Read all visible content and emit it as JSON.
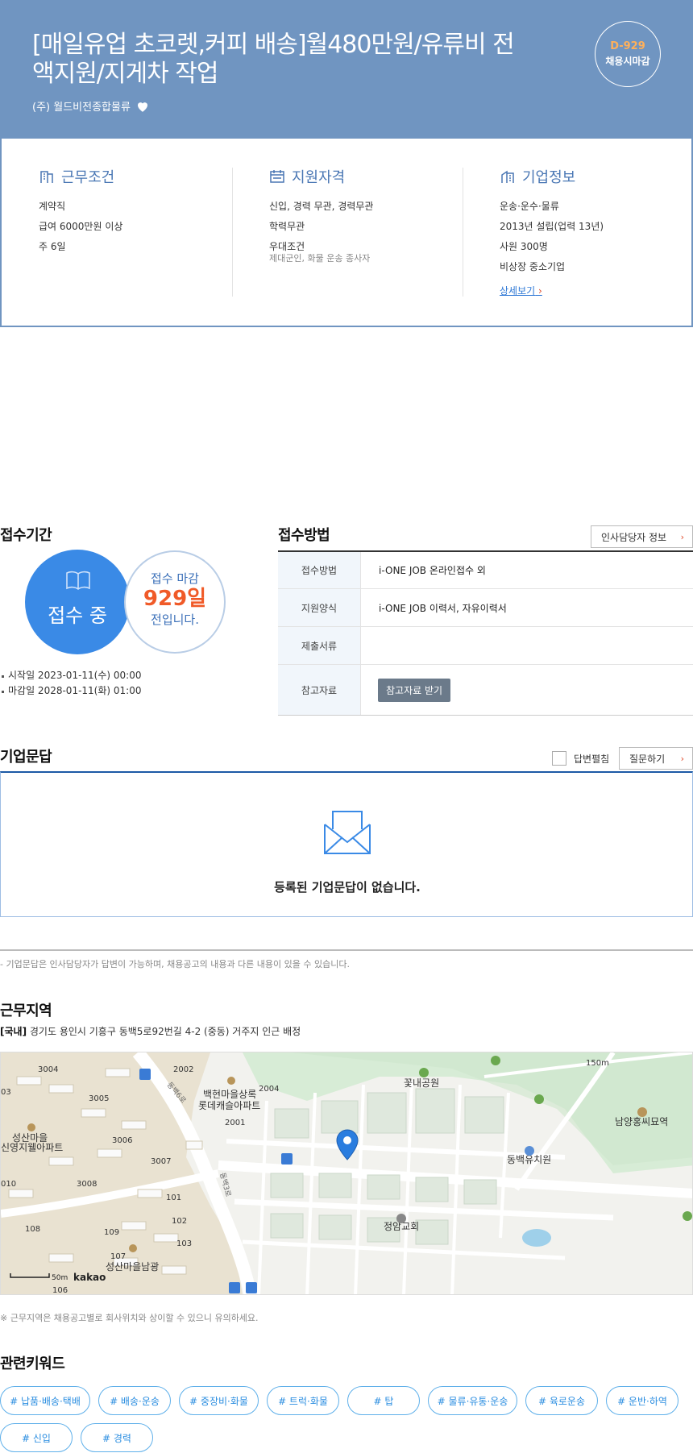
{
  "header": {
    "title": "[매일유업 초코렛,커피 배송]월480만원/유류비 전액지원/지게차 작업",
    "company": "(주) 월드비전종합물류",
    "dday": "D-929",
    "deadline_type": "채용시마감"
  },
  "summary": {
    "work": {
      "title": "근무조건",
      "lines": [
        "계약직",
        "급여 6000만원 이상",
        "주 6일"
      ]
    },
    "qual": {
      "title": "지원자격",
      "lines": [
        "신입, 경력 무관, 경력무관",
        "학력무관",
        "우대조건"
      ],
      "sub": "제대군인, 화물 운송 종사자"
    },
    "corp": {
      "title": "기업정보",
      "lines": [
        "운송·운수·물류",
        "2013년 설립(업력 13년)",
        "사원 300명",
        "비상장 중소기업"
      ],
      "link": "상세보기"
    }
  },
  "period": {
    "title": "접수기간",
    "status": "접수 중",
    "remain_top": "접수 마감",
    "remain_days": "929일",
    "remain_bottom": "전입니다.",
    "start": "시작일 2023-01-11(수) 00:00",
    "end": "마감일 2028-01-11(화) 01:00"
  },
  "method": {
    "title": "접수방법",
    "hr_button": "인사담당자 정보",
    "rows": [
      {
        "label": "접수방법",
        "value": "i-ONE JOB 온라인접수 외"
      },
      {
        "label": "지원양식",
        "value": "i-ONE JOB 이력서, 자유이력서"
      },
      {
        "label": "제출서류",
        "value": ""
      },
      {
        "label": "참고자료",
        "button": "참고자료 받기"
      }
    ]
  },
  "qna": {
    "title": "기업문답",
    "expand_label": "답변펼침",
    "ask_button": "질문하기",
    "empty": "등록된 기업문답이 없습니다.",
    "note": "- 기업문답은 인사담당자가 답변이 가능하며, 채용공고의 내용과 다른 내용이 있을 수 있습니다."
  },
  "location": {
    "title": "근무지역",
    "region": "[국내]",
    "address": "경기도 용인시 기흥구 동백5로92번길 4-2 (중동) 거주지 인근 배정",
    "note": "※ 근무지역은 채용공고별로 회사위치와 상이할 수 있으니 유의하세요.",
    "map_labels": {
      "park": "꽃내공원",
      "apt1": "백현마을상록",
      "apt1b": "롯데캐슬아파트",
      "apt2": "성산마을",
      "apt2b": "신영지웰아파트",
      "grave": "남양홍씨묘역",
      "kinder": "동백유치원",
      "church": "정암교회",
      "apt3": "성산마을남광",
      "road1": "동백6로",
      "road2": "동백3로",
      "n3004": "3004",
      "n2002": "2002",
      "n2004": "2004",
      "n3005": "3005",
      "n2001": "2001",
      "n3006": "3006",
      "n3007": "3007",
      "n3008": "3008",
      "n101": "101",
      "n102": "102",
      "n103": "103",
      "n108": "108",
      "n109": "109",
      "n107": "107",
      "n106": "106",
      "n010": "010",
      "n03": "03",
      "scale_top": "150m",
      "scale": "50m",
      "brand": "kakao"
    }
  },
  "keywords": {
    "title": "관련키워드",
    "items": [
      "# 납품·배송·택배",
      "# 배송·운송",
      "# 중장비·화물",
      "# 트럭·화물",
      "# 탑",
      "# 물류·유통·운송",
      "# 육로운송",
      "# 운반·하역",
      "# 신입",
      "# 경력"
    ]
  },
  "colors": {
    "header_bg": "#7095c1",
    "accent_blue": "#3a8ae6",
    "dday": "#ffb05a",
    "days_red": "#f05a28"
  }
}
